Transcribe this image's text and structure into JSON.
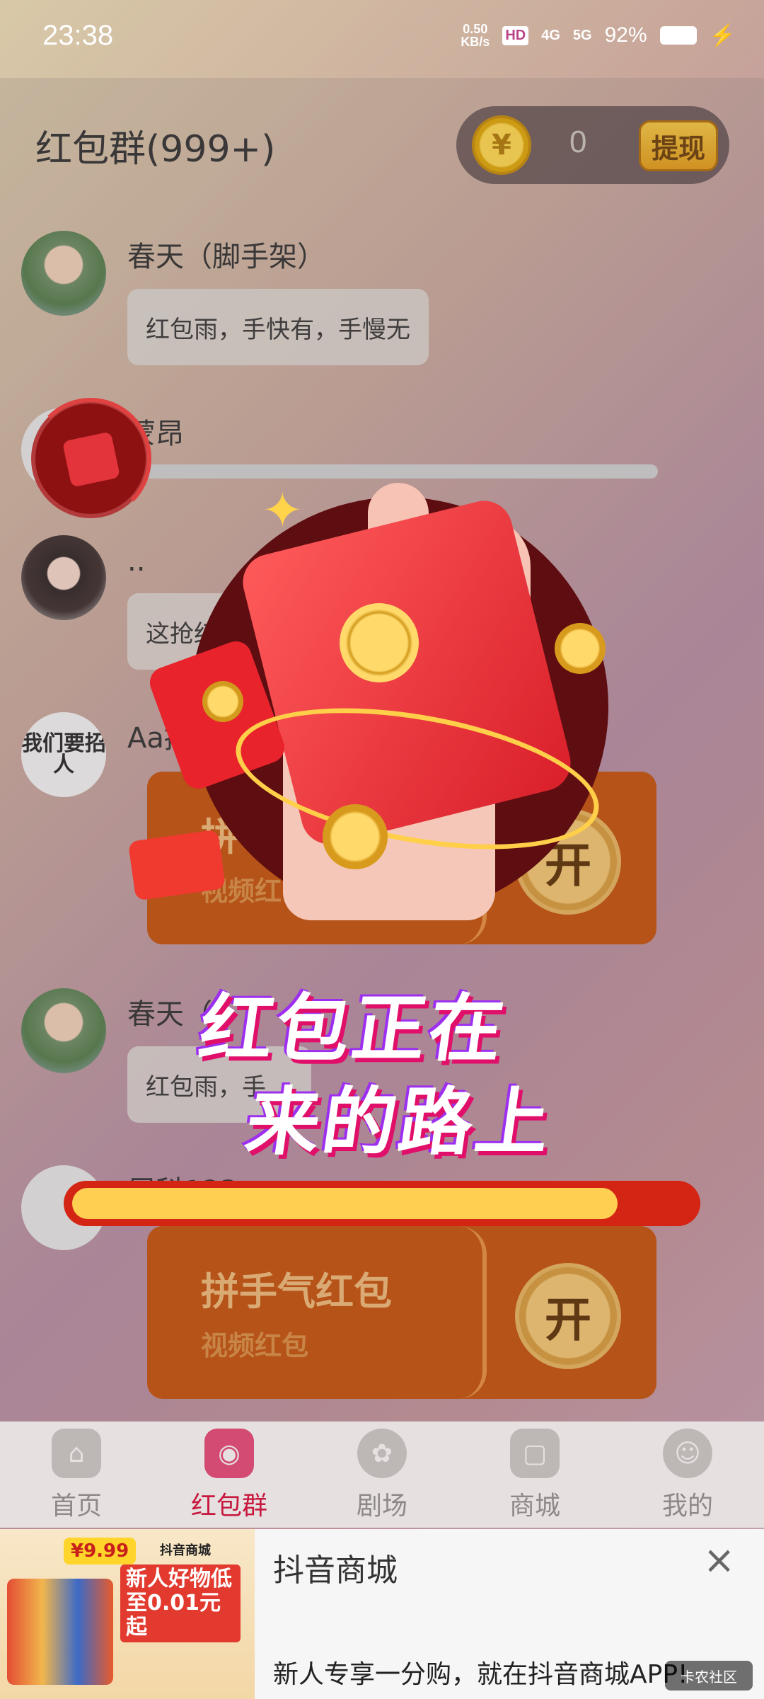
{
  "status_bar": {
    "time": "23:38",
    "net_speed_top": "0.50",
    "net_speed_unit": "KB/s",
    "hd": "HD",
    "signal_4g": "4G",
    "signal_5g": "5G",
    "battery": "92%"
  },
  "header": {
    "title": "红包群(999+)",
    "coin_symbol": "¥",
    "coin_count": "0",
    "withdraw_label": "提现"
  },
  "messages": [
    {
      "nick": "春天（脚手架）",
      "text": "红包雨，手快有，手慢无"
    },
    {
      "nick": "蒙昂"
    },
    {
      "nick": "..",
      "text": "这抢红"
    },
    {
      "nick": "Aa招",
      "avatar_text": "我们要招人",
      "packet_title": "拼",
      "packet_sub": "视频红",
      "open": "开"
    },
    {
      "nick": "春天（",
      "text": "红包雨，手"
    },
    {
      "nick": "周科123",
      "packet_title": "拼手气红包",
      "packet_sub": "视频红包",
      "open": "开"
    }
  ],
  "promo": {
    "line1": "红包正在",
    "line2": "来的路上",
    "progress": 0.88
  },
  "nav": [
    {
      "label": "首页",
      "icon": "home-icon",
      "active": false
    },
    {
      "label": "红包群",
      "icon": "red-packet-icon",
      "active": true
    },
    {
      "label": "剧场",
      "icon": "film-reel-icon",
      "active": false
    },
    {
      "label": "商城",
      "icon": "shopping-bag-icon",
      "active": false
    },
    {
      "label": "我的",
      "icon": "smiley-icon",
      "active": false
    }
  ],
  "ad": {
    "price": "¥9.99",
    "brand": "抖音商城",
    "promo_text": "新人好物低至0.01元起",
    "title": "抖音商城",
    "desc": "新人专享一分购，就在抖音商城APP!",
    "close": "×"
  },
  "watermark": "卡农社区",
  "colors": {
    "accent_red": "#d32414",
    "active_nav": "#c7183e",
    "gold": "#ffcf52"
  }
}
